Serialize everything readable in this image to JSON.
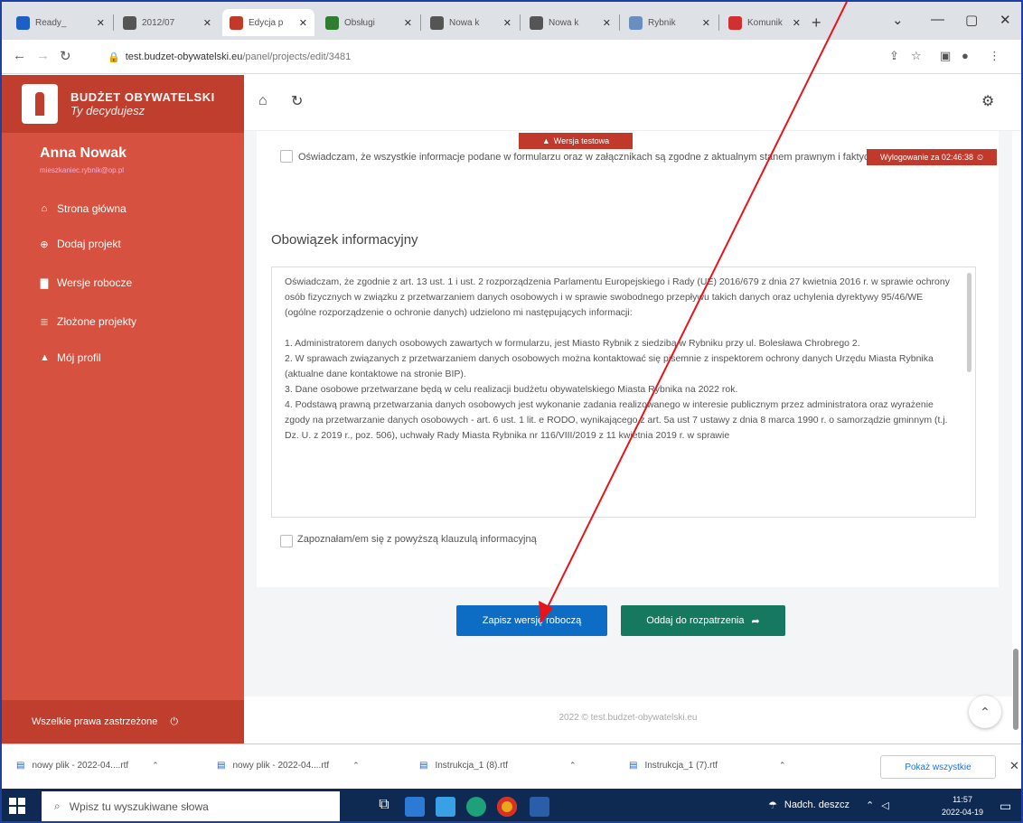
{
  "tabs": [
    {
      "title": "Ready_",
      "color": "#1e5fc4"
    },
    {
      "title": "2012/07",
      "color": "#555555"
    },
    {
      "title": "Edycja p",
      "color": "#c0392b"
    },
    {
      "title": "Obsługi",
      "color": "#2e7d32"
    },
    {
      "title": "Nowa k",
      "color": "#555555"
    },
    {
      "title": "Nowa k",
      "color": "#555555"
    },
    {
      "title": "Rybnik",
      "color": "#6a8fbf"
    },
    {
      "title": "Komunik",
      "color": "#d03030"
    }
  ],
  "address": {
    "host": "test.budzet-obywatelski.eu",
    "path": "/panel/projects/edit/3481"
  },
  "brand": {
    "title": "BUDŻET OBYWATELSKI",
    "subtitle": "Ty decydujesz"
  },
  "user": {
    "name": "Anna Nowak",
    "email": "mieszkaniec.rybnik@op.pl"
  },
  "nav": [
    {
      "label": "Strona główna",
      "icon": "home-icon"
    },
    {
      "label": "Dodaj projekt",
      "icon": "plus-circle-icon"
    },
    {
      "label": "Wersje robocze",
      "icon": "file-icon"
    },
    {
      "label": "Złożone projekty",
      "icon": "list-icon"
    },
    {
      "label": "Mój profil",
      "icon": "user-icon"
    }
  ],
  "sidebar_footer": "Wszelkie prawa zastrzeżone",
  "banner": "Wersja testowa",
  "logout": "Wylogowanie za 02:46:38",
  "declaration": "Oświadczam, że wszystkie informacje podane w formularzu oraz w załącznikach są zgodne z aktualnym stanem prawnym i faktycznym.",
  "section_title": "Obowiązek informacyjny",
  "info": {
    "p1": "Oświadczam, że zgodnie z art. 13 ust. 1 i ust. 2 rozporządzenia Parlamentu Europejskiego i Rady (UE) 2016/679 z dnia 27 kwietnia 2016 r. w sprawie ochrony osób fizycznych w związku z przetwarzaniem danych osobowych i w sprawie swobodnego przepływu takich danych oraz uchylenia dyrektywy 95/46/WE (ogólne rozporządzenie o ochronie danych) udzielono mi następujących informacji:",
    "p2": "1. Administratorem danych osobowych zawartych w formularzu, jest Miasto Rybnik z siedzibą w Rybniku przy ul. Bolesława Chrobrego 2.",
    "p3": "2. W sprawach związanych z przetwarzaniem danych osobowych można kontaktować się pisemnie z inspektorem ochrony danych Urzędu Miasta Rybnika (aktualne dane kontaktowe na stronie BIP).",
    "p4": "3. Dane osobowe przetwarzane będą w celu realizacji budżetu obywatelskiego Miasta Rybnika na 2022 rok.",
    "p5": "4. Podstawą prawną przetwarzania danych osobowych jest wykonanie zadania realizowanego w interesie publicznym przez administratora oraz wyrażenie zgody na przetwarzanie danych osobowych - art. 6 ust. 1 lit. e RODO, wynikającego z art. 5a ust 7 ustawy z dnia 8 marca 1990 r. o samorządzie gminnym (t.j. Dz. U. z 2019 r., poz. 506), uchwały Rady Miasta Rybnika nr 116/VIII/2019 z 11 kwietnia 2019 r. w sprawie"
  },
  "consent": "Zapoznałam/em się z powyższą klauzulą informacyjną",
  "buttons": {
    "save": "Zapisz wersję roboczą",
    "submit": "Oddaj do rozpatrzenia"
  },
  "footer": "2022 © test.budzet-obywatelski.eu",
  "downloads": [
    "nowy plik - 2022-04....rtf",
    "nowy plik - 2022-04....rtf",
    "Instrukcja_1 (8).rtf",
    "Instrukcja_1 (7).rtf"
  ],
  "downloads_show_all": "Pokaż wszystkie",
  "taskbar": {
    "search": "Wpisz tu wyszukiwane słowa",
    "weather": "Nadch. deszcz",
    "time": "11:57",
    "date": "2022-04-19"
  },
  "annotation_arrow_color": "#e8141c"
}
